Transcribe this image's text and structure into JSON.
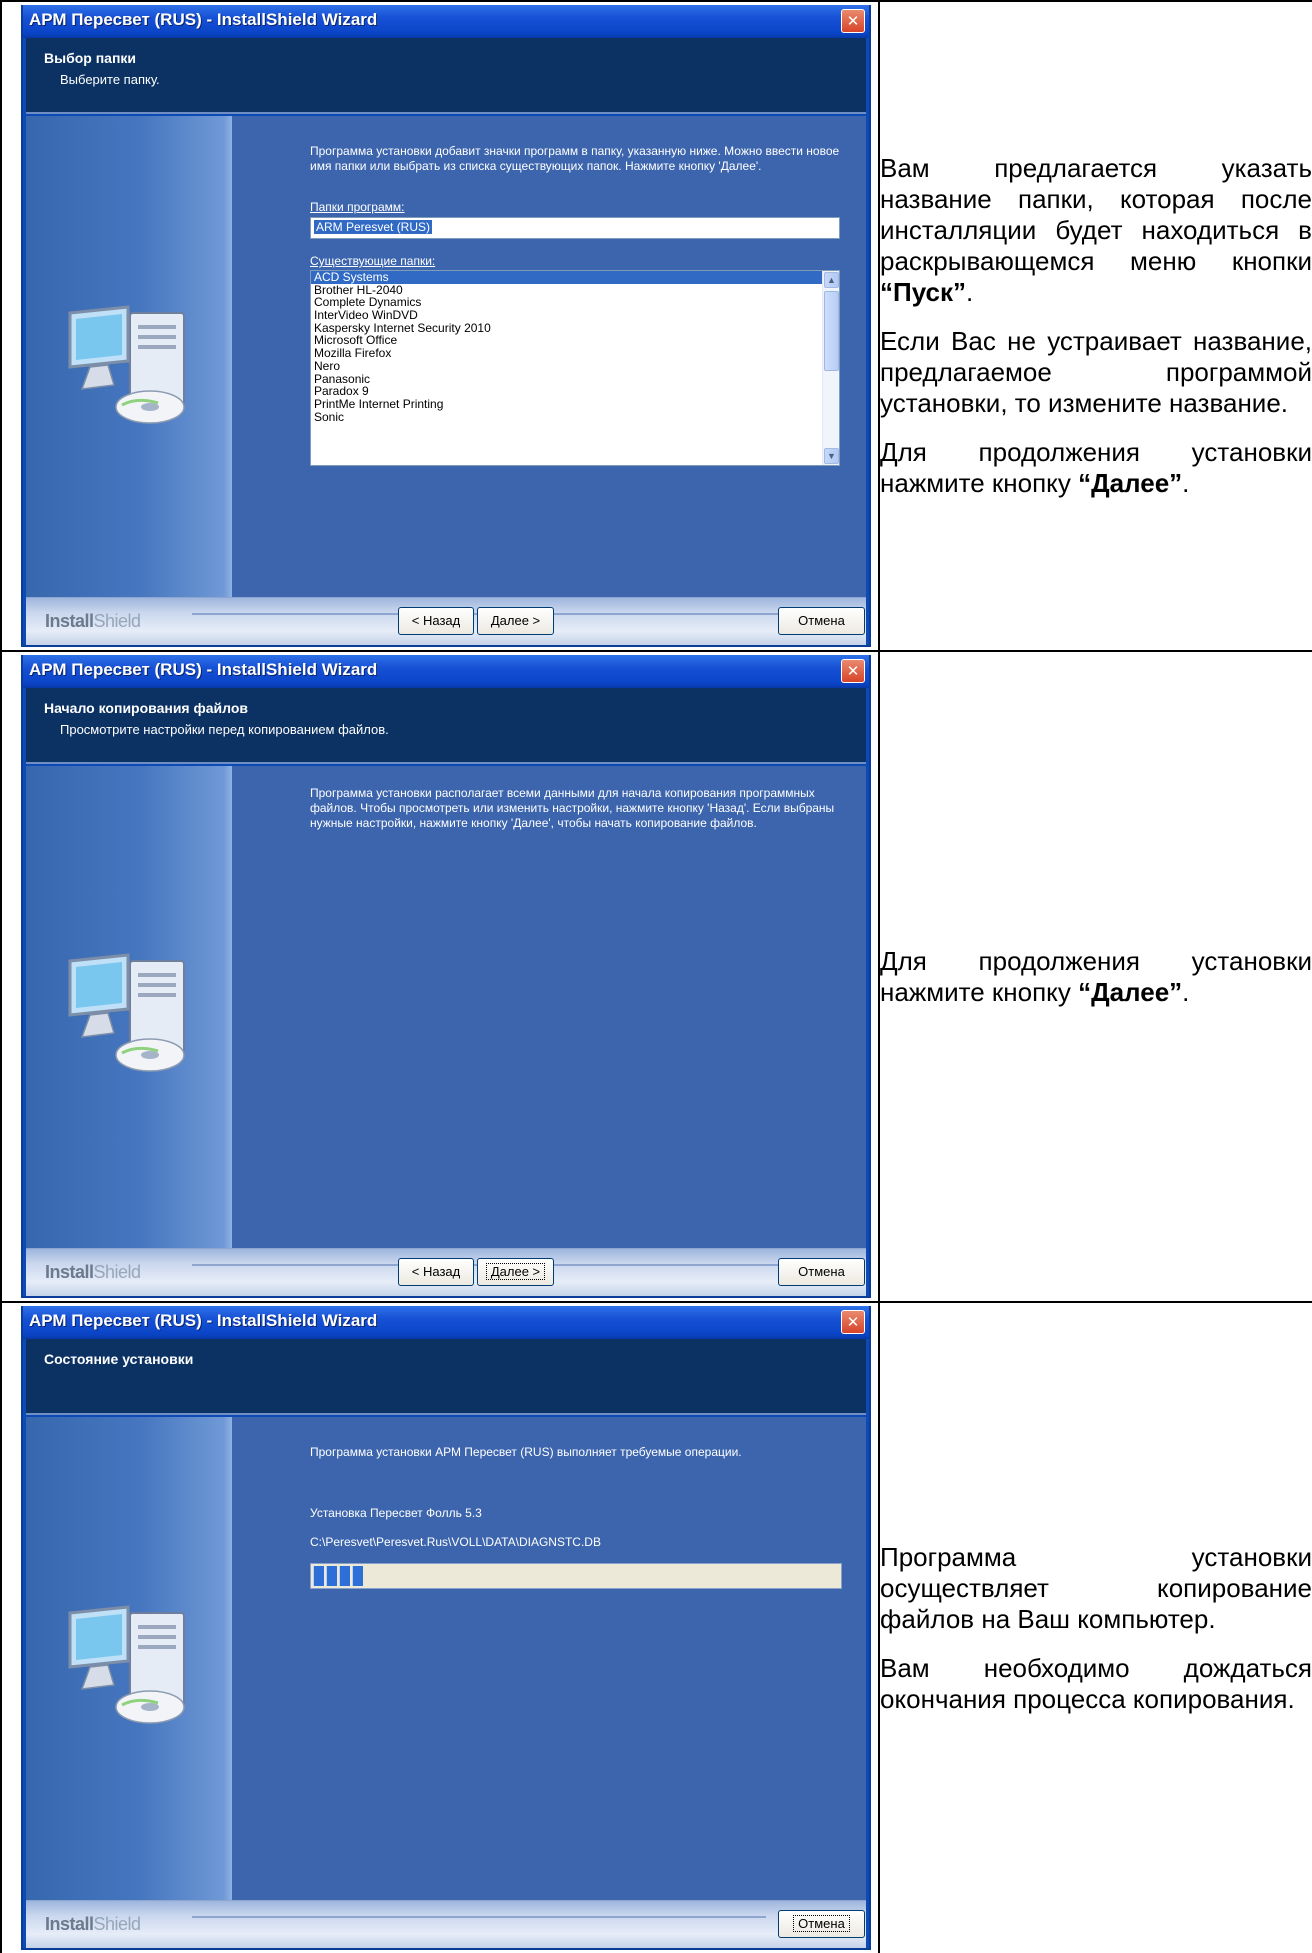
{
  "common": {
    "title": "АРМ Пересвет (RUS) - InstallShield Wizard",
    "close_glyph": "✕",
    "brand_a": "Install",
    "brand_b": "Shield",
    "back_label": "< Назад",
    "next_label": "Далее >",
    "cancel_label": "Отмена"
  },
  "screen1": {
    "header_title": "Выбор папки",
    "header_subtitle": "Выберите папку.",
    "intro": "Программа установки добавит значки программ в папку, указанную ниже.  Можно ввести новое имя папки или выбрать из списка существующих папок.  Нажмите кнопку 'Далее'.",
    "folder_label": "Папки программ:",
    "folder_value": "ARM Peresvet (RUS)",
    "existing_label": "Существующие папки:",
    "existing_folders": [
      "ACD Systems",
      "Brother HL-2040",
      "Complete Dynamics",
      "InterVideo WinDVD",
      "Kaspersky Internet Security 2010",
      "Microsoft Office",
      "Mozilla Firefox",
      "Nero",
      "Panasonic",
      "Paradox 9",
      "PrintMe Internet Printing",
      "Sonic"
    ],
    "selected_folder": "ACD Systems",
    "desc": {
      "p1_pre": "Вам предлагается указать название папки, которая после инсталляции будет находиться в раскрывающемся меню кнопки ",
      "p1_bold": "“Пуск”",
      "p1_post": ".",
      "p2": "Если Вас не устраивает название, предлагаемое программой установки, то измените название.",
      "p3_pre": "Для продолжения установки нажмите кнопку ",
      "p3_bold": "“Далее”",
      "p3_post": "."
    }
  },
  "screen2": {
    "header_title": "Начало копирования файлов",
    "header_subtitle": "Просмотрите настройки перед копированием файлов.",
    "intro": "Программа установки располагает всеми данными для начала копирования программных файлов.  Чтобы просмотреть или изменить настройки, нажмите кнопку 'Назад'.  Если выбраны нужные настройки, нажмите кнопку 'Далее', чтобы начать копирование файлов.",
    "desc": {
      "p1_pre": "Для продолжения установки нажмите кнопку ",
      "p1_bold": "“Далее”",
      "p1_post": "."
    }
  },
  "screen3": {
    "header_title": "Состояние установки",
    "intro": "Программа установки АРМ Пересвет (RUS) выполняет требуемые операции.",
    "status_line": "Установка Пересвет Фолль 5.3",
    "file_path": "C:\\Peresvet\\Peresvet.Rus\\VOLL\\DATA\\DIAGNSTC.DB",
    "progress": 0.1,
    "desc": {
      "p1": "Программа установки осуществляет копирование файлов на Ваш компьютер.",
      "p2": "Вам необходимо дождаться окончания процесса копирования."
    }
  }
}
